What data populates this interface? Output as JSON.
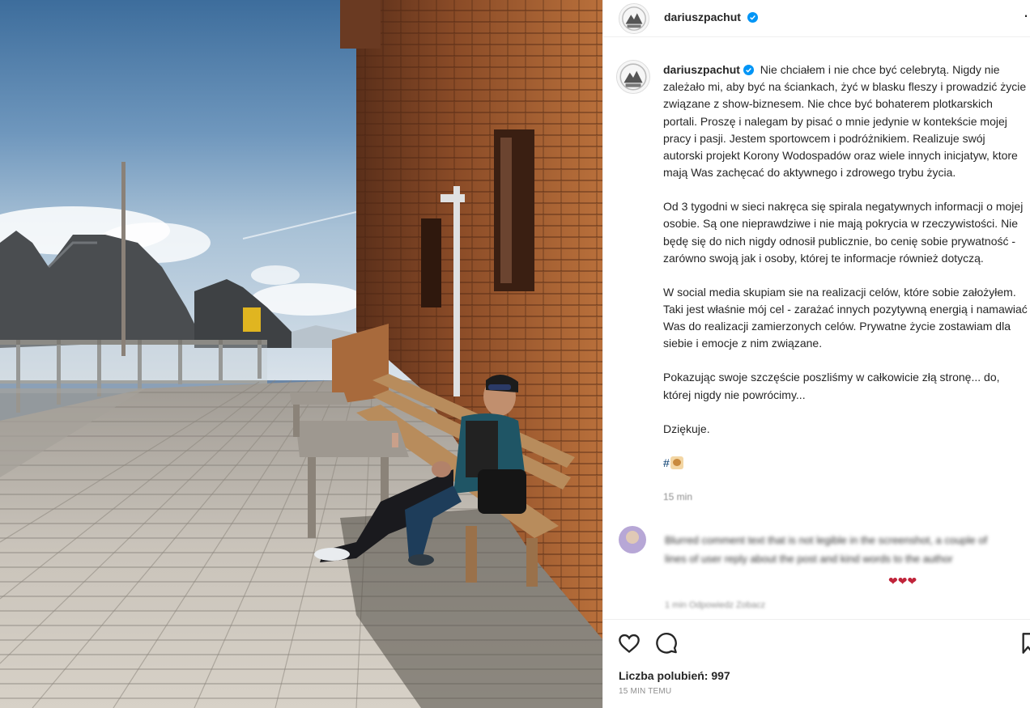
{
  "post": {
    "username": "dariuszpachut",
    "verified_icon": "verified-badge-icon",
    "more_icon": "more-options-icon",
    "image_description_icon": "photo"
  },
  "caption": {
    "paragraphs": [
      "Nie chciałem i nie chce być celebrytą. Nigdy nie zależało mi, aby być na ściankach, żyć w blasku fleszy i prowadzić życie związane z show-biznesem. Nie chce być bohaterem plotkarskich portali. Proszę i nalegam by pisać o mnie jedynie w kontekście mojej pracy i pasji. Jestem sportowcem i podróżnikiem. Realizuje swój autorski projekt Korony Wodospadów oraz wiele innych inicjatyw, ktore mają Was zachęcać do aktywnego i zdrowego trybu życia.",
      "Od 3 tygodni w sieci nakręca się spirala negatywnych informacji o mojej osobie. Są one nieprawdziwe i nie mają pokrycia w rzeczywistości. Nie będę się do nich nigdy odnosił publicznie, bo cenię sobie prywatność - zarówno swoją jak i osoby, której te informacje również dotyczą.",
      "W social media skupiam sie na realizacji celów, które sobie założyłem. Taki jest właśnie mój cel - zarażać innych pozytywną energią i namawiać Was do realizacji zamierzonych celów. Prywatne życie zostawiam dla siebie i emocje z nim związane.",
      "Pokazując swoje szczęście poszliśmy w całkowicie złą stronę... do, której nigdy nie powrócimy...",
      "Dziękuje."
    ],
    "hashtag": "#",
    "time": "15 min"
  },
  "comment": {
    "text": "Blurred comment text that is not legible in the screenshot, a couple of lines of user reply about the post and kind words to the author",
    "hearts": "❤❤❤",
    "meta": "1 min   Odpowiedz   Zobacz"
  },
  "actions": {
    "like_icon": "heart-icon",
    "comment_icon": "comment-icon",
    "save_icon": "bookmark-icon",
    "likes_label": "Liczba polubień: 997",
    "timestamp": "15 MIN TEMU"
  },
  "colors": {
    "text": "#262626",
    "muted": "#8e8e8e",
    "verified": "#0095f6",
    "hashtag": "#00376b",
    "border": "#efefef"
  }
}
